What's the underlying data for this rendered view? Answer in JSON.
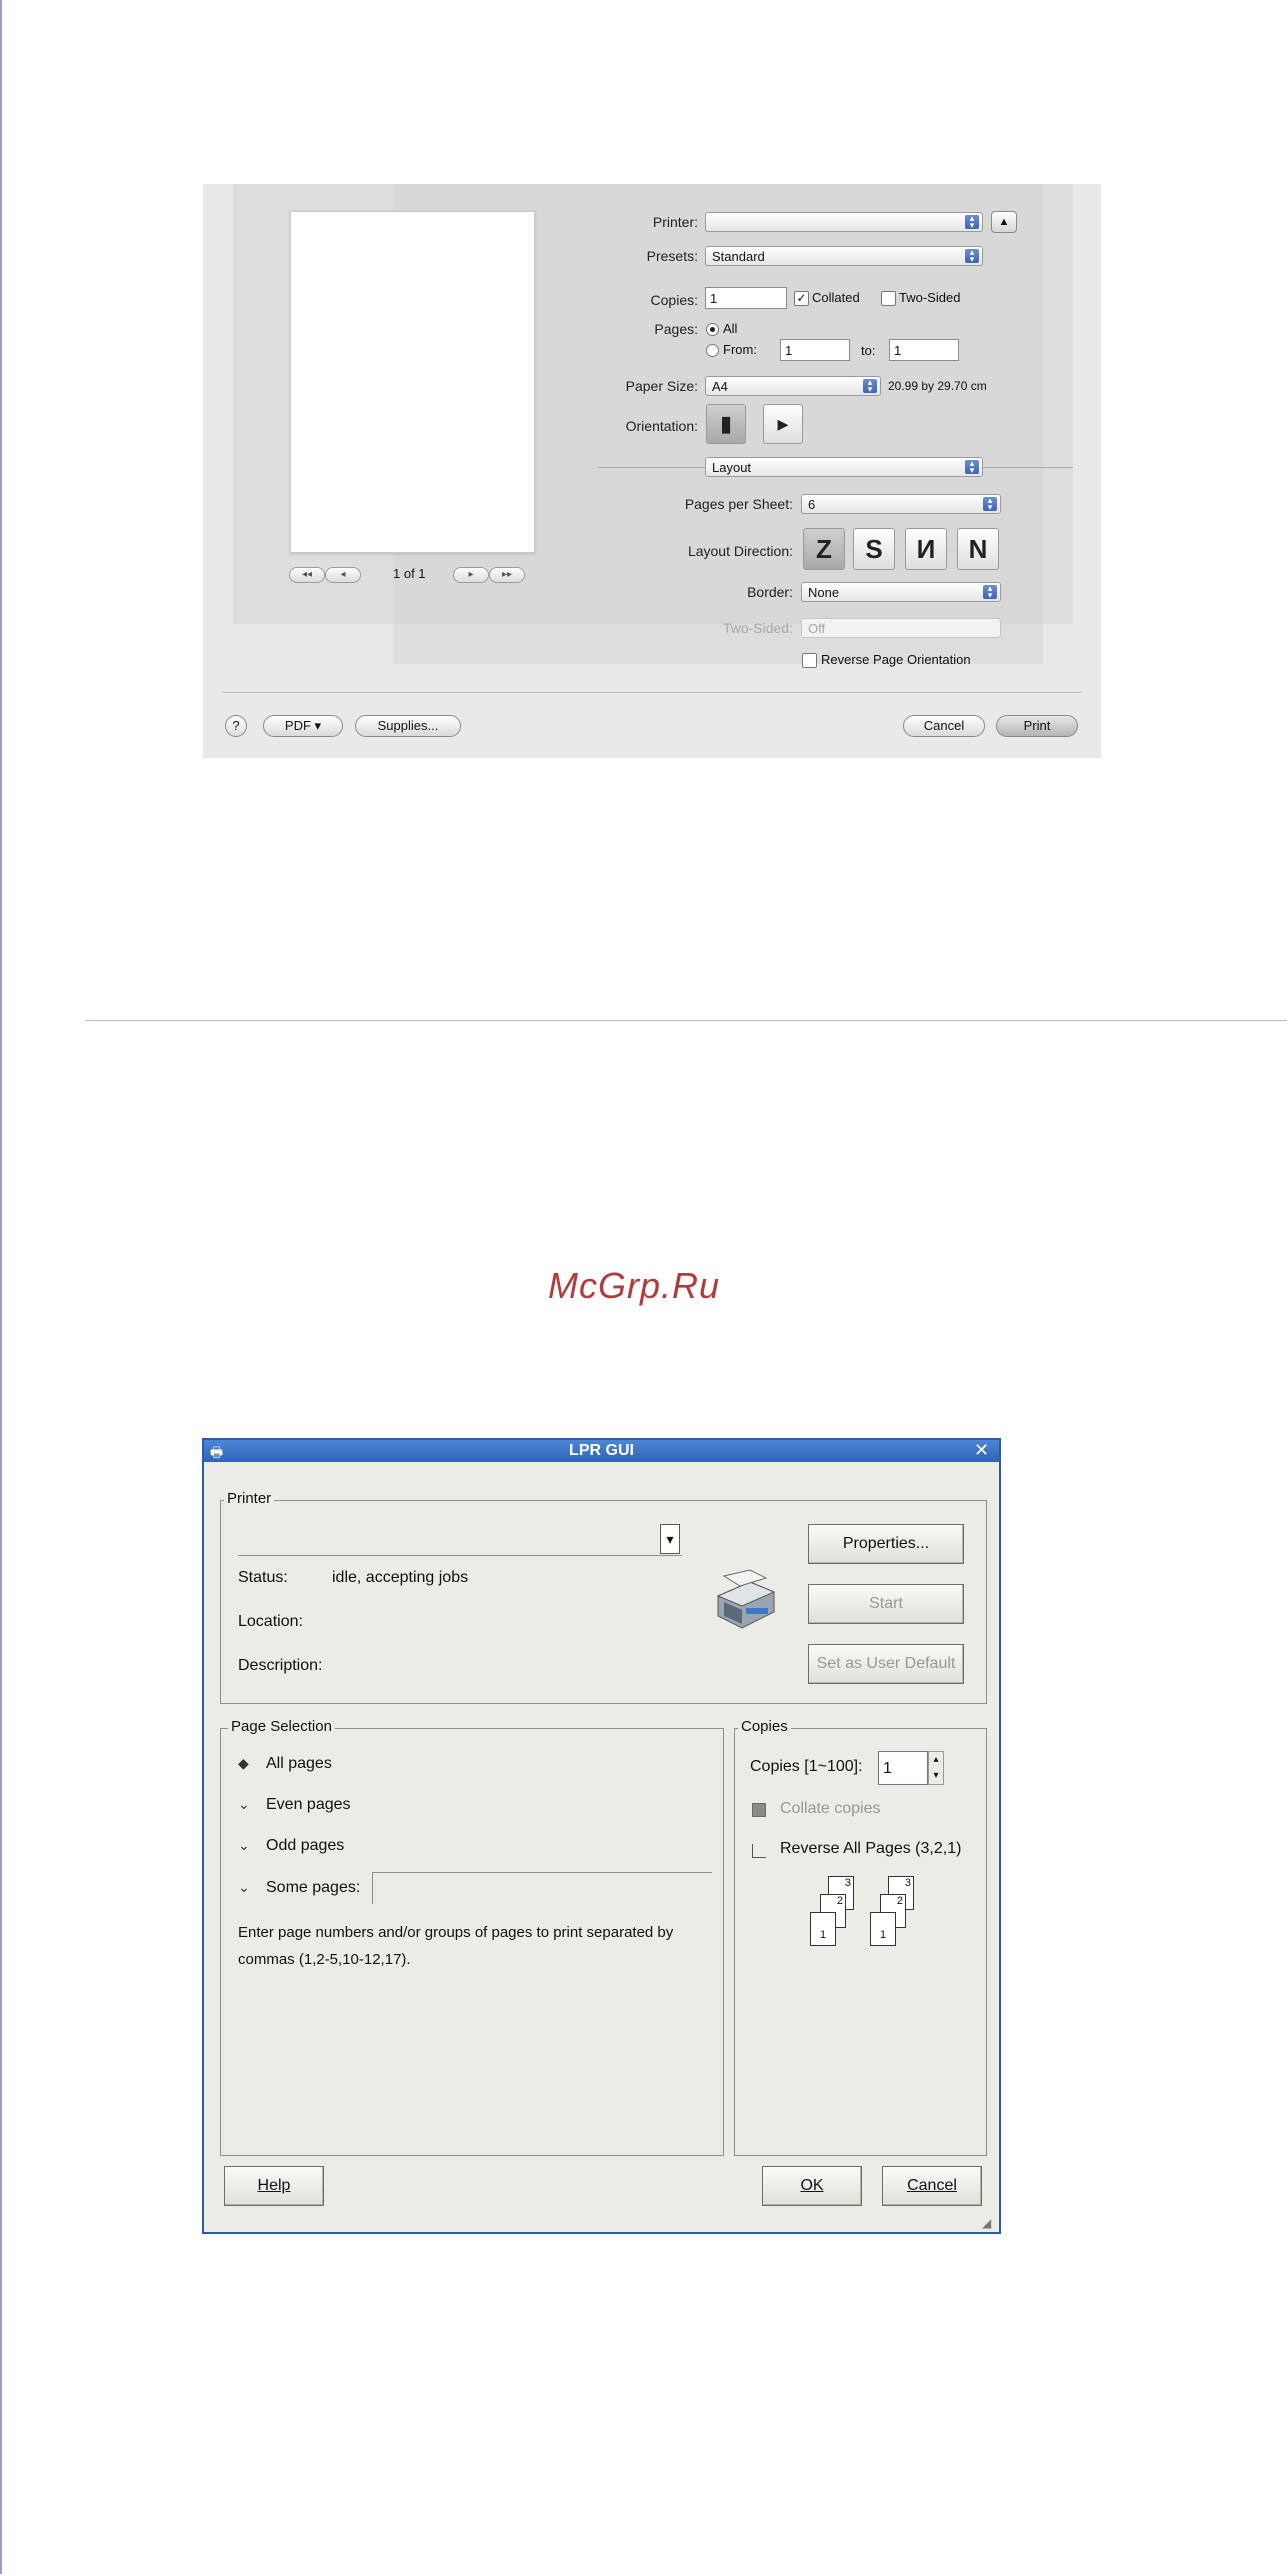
{
  "watermark": "McGrp.Ru",
  "mac_dialog": {
    "printer_label": "Printer:",
    "presets_label": "Presets:",
    "presets_value": "Standard",
    "copies_label": "Copies:",
    "copies_value": "1",
    "collated_label": "Collated",
    "collated_checked": true,
    "two_sided_label": "Two-Sided",
    "pages_label": "Pages:",
    "all_label": "All",
    "from_label": "From:",
    "from_value": "1",
    "to_label": "to:",
    "to_value": "1",
    "paper_size_label": "Paper Size:",
    "paper_size_value": "A4",
    "paper_size_dims": "20.99 by 29.70 cm",
    "orientation_label": "Orientation:",
    "section_value": "Layout",
    "pages_per_sheet_label": "Pages per Sheet:",
    "pages_per_sheet_value": "6",
    "layout_direction_label": "Layout Direction:",
    "layout_directions": [
      "Z",
      "S",
      "И",
      "N"
    ],
    "border_label": "Border:",
    "border_value": "None",
    "two_sided_select_label": "Two-Sided:",
    "two_sided_select_value": "Off",
    "reverse_label": "Reverse Page Orientation",
    "page_count": "1 of 1",
    "nav_first": "◂◂",
    "nav_prev": "◂",
    "nav_next": "▸",
    "nav_last": "▸▸",
    "help_glyph": "?",
    "pdf_label": "PDF ▾",
    "supplies_label": "Supplies...",
    "cancel_label": "Cancel",
    "print_label": "Print"
  },
  "lpr_dialog": {
    "title": "LPR GUI",
    "printer_group": "Printer",
    "status_label": "Status:",
    "status_value": "idle, accepting jobs",
    "location_label": "Location:",
    "description_label": "Description:",
    "properties_button": "Properties...",
    "start_button": "Start",
    "set_default_button": "Set as User Default",
    "page_selection_group": "Page Selection",
    "all_pages": "All pages",
    "even_pages": "Even pages",
    "odd_pages": "Odd pages",
    "some_pages": "Some pages:",
    "hint": "Enter page numbers and/or groups of pages to print separated by commas (1,2-5,10-12,17).",
    "copies_group": "Copies",
    "copies_label": "Copies [1~100]:",
    "copies_value": "1",
    "collate_label": "Collate copies",
    "reverse_label": "Reverse All Pages (3,2,1)",
    "help_button": "Help",
    "ok_button": "OK",
    "cancel_button": "Cancel",
    "stack_pages": [
      "3",
      "2",
      "1",
      "3",
      "2",
      "1"
    ]
  }
}
